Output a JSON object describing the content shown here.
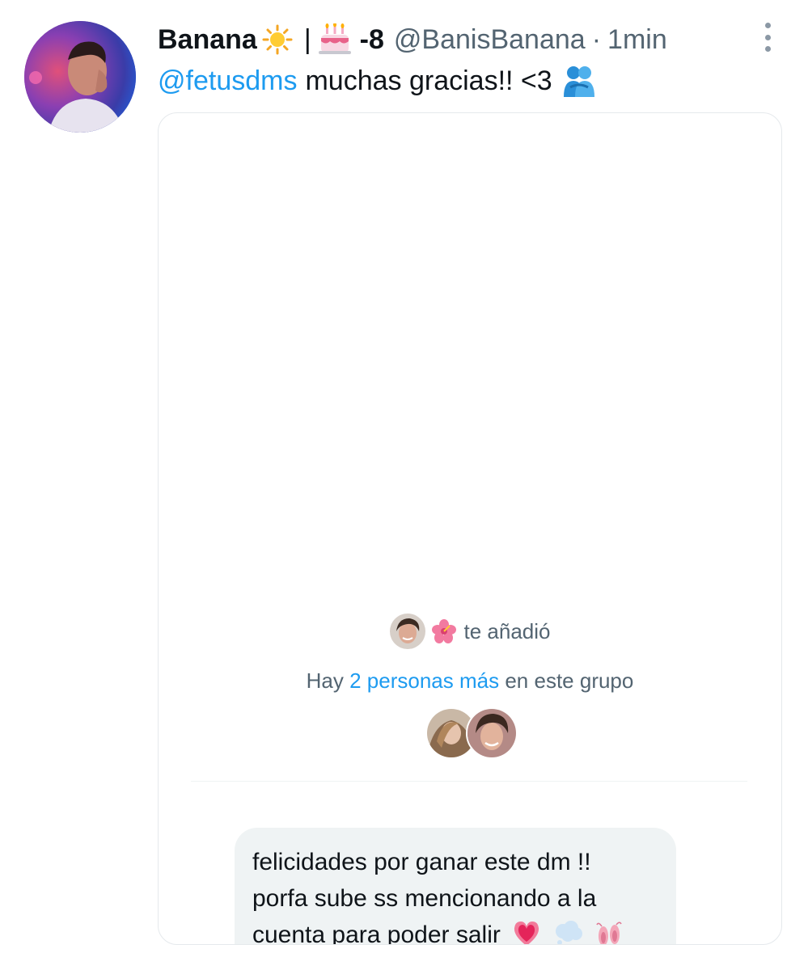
{
  "tweet": {
    "display_name": "Banana",
    "separator": "|",
    "name_suffix": "-8",
    "handle": "@BanisBanana",
    "dot": "·",
    "time": "1min",
    "mention": "@fetusdms",
    "text": "muchas gracias!! <3",
    "icons": {
      "sun": "sun-emoji",
      "cake": "birthday-cake-emoji",
      "hug": "people-hugging-emoji",
      "more": "more-options-icon"
    }
  },
  "media": {
    "added_text": "te añadió",
    "group_prefix": "Hay",
    "group_link": "2 personas más",
    "group_suffix": "en este grupo",
    "message": {
      "lines": [
        "felicidades por ganar este dm !!",
        "porfa sube ss mencionando a la",
        "cuenta para poder salir"
      ],
      "emojis": [
        "heart-emoji",
        "thought-balloon-emoji",
        "ballet-shoes-emoji"
      ]
    }
  },
  "colors": {
    "link": "#1d9bf0",
    "secondary_text": "#536471",
    "bubble_bg": "#eff3f4"
  }
}
